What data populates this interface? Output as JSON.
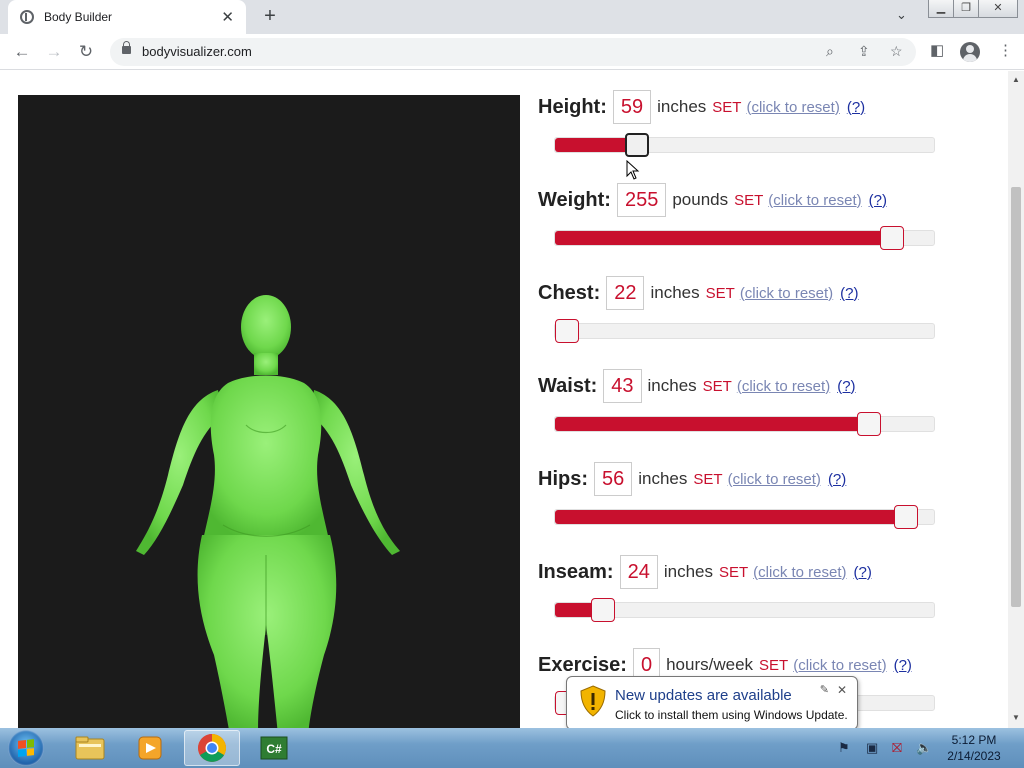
{
  "browser": {
    "tab_title": "Body Builder",
    "url": "bodyvisualizer.com",
    "window_controls": [
      "minimize-icon",
      "restore-icon",
      "close-icon"
    ]
  },
  "controls": [
    {
      "key": "height",
      "label": "Height:",
      "value": "59",
      "unit": "inches",
      "fill_fraction": 0.195,
      "active": true
    },
    {
      "key": "weight",
      "label": "Weight:",
      "value": "255",
      "unit": "pounds",
      "fill_fraction": 0.91,
      "active": false
    },
    {
      "key": "chest",
      "label": "Chest:",
      "value": "22",
      "unit": "inches",
      "fill_fraction": 0.0,
      "active": false
    },
    {
      "key": "waist",
      "label": "Waist:",
      "value": "43",
      "unit": "inches",
      "fill_fraction": 0.845,
      "active": false
    },
    {
      "key": "hips",
      "label": "Hips:",
      "value": "56",
      "unit": "inches",
      "fill_fraction": 0.95,
      "active": false
    },
    {
      "key": "inseam",
      "label": "Inseam:",
      "value": "24",
      "unit": "inches",
      "fill_fraction": 0.1,
      "active": false
    },
    {
      "key": "exercise",
      "label": "Exercise:",
      "value": "0",
      "unit": "hours/week",
      "fill_fraction": 0.0,
      "active": false
    }
  ],
  "set_label": "SET",
  "reset_label": "(click to reset)",
  "help_label": "(?)",
  "model": {
    "color": "#7fe35a",
    "background": "#1b1b1b"
  },
  "notification": {
    "title": "New updates are available",
    "body": "Click to install them using Windows Update."
  },
  "taskbar": {
    "time": "5:12 PM",
    "date": "2/14/2023",
    "apps": [
      "folder-icon",
      "media-player-icon",
      "chrome-icon",
      "csharp-icon"
    ]
  },
  "colors": {
    "accent": "#c8102e",
    "link": "#7a86b3",
    "help_link": "#1c2fa0"
  }
}
